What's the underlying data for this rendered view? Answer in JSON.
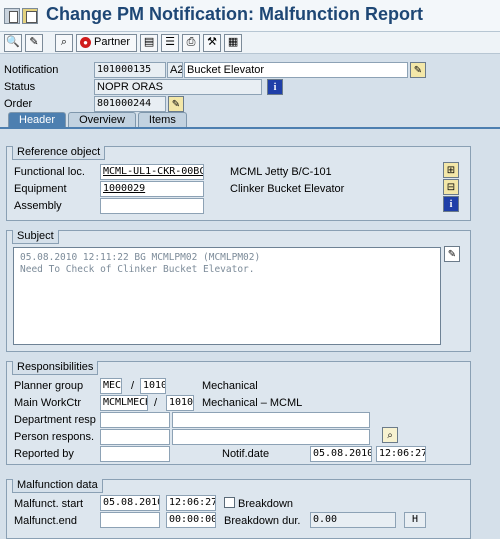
{
  "window": {
    "title": "Change PM Notification: Malfunction Report"
  },
  "toolbar": {
    "partner_label": "Partner"
  },
  "header": {
    "notification_label": "Notification",
    "notification_value": "101000135",
    "notification_type": "A2",
    "notification_desc": "Bucket Elevator",
    "status_label": "Status",
    "status_value": "NOPR ORAS",
    "order_label": "Order",
    "order_value": "801000244"
  },
  "tabs": [
    {
      "label": "Header"
    },
    {
      "label": "Overview"
    },
    {
      "label": "Items"
    }
  ],
  "reference_object": {
    "title": "Reference object",
    "functional_loc_label": "Functional loc.",
    "functional_loc_value": "MCML-UL1-CKR-00BC1(",
    "functional_loc_desc": "MCML Jetty B/C-101",
    "equipment_label": "Equipment",
    "equipment_value": "1000029",
    "equipment_desc": "Clinker Bucket Elevator",
    "assembly_label": "Assembly",
    "assembly_value": ""
  },
  "subject": {
    "title": "Subject",
    "line1": "05.08.2010 12:11:22 BG MCMLPM02 (MCMLPM02)",
    "line2": "Need To Check of Clinker Bucket Elevator."
  },
  "responsibilities": {
    "title": "Responsibilities",
    "planner_group_label": "Planner group",
    "planner_group_value": "MEC",
    "planner_group_plant": "1010",
    "planner_group_desc": "Mechanical",
    "slash": "/",
    "main_workctr_label": "Main WorkCtr",
    "main_workctr_value": "MCMLMECH",
    "main_workctr_plant": "1010",
    "main_workctr_desc": "Mechanical – MCML",
    "department_label": "Department resp",
    "person_label": "Person respons.",
    "reported_by_label": "Reported by",
    "notif_date_label": "Notif.date",
    "notif_date_value": "05.08.2010",
    "notif_time_value": "12:06:27"
  },
  "malfunction": {
    "title": "Malfunction data",
    "start_label": "Malfunct. start",
    "start_date": "05.08.2010",
    "start_time": "12:06:27",
    "breakdown_label": "Breakdown",
    "end_label": "Malfunct.end",
    "end_date": "",
    "end_time": "00:00:00",
    "breakdown_dur_label": "Breakdown dur.",
    "breakdown_dur_value": "0.00",
    "breakdown_unit": "H"
  },
  "colors": {
    "accent": "#1e4775",
    "tab_active": "#4d7fb0"
  }
}
